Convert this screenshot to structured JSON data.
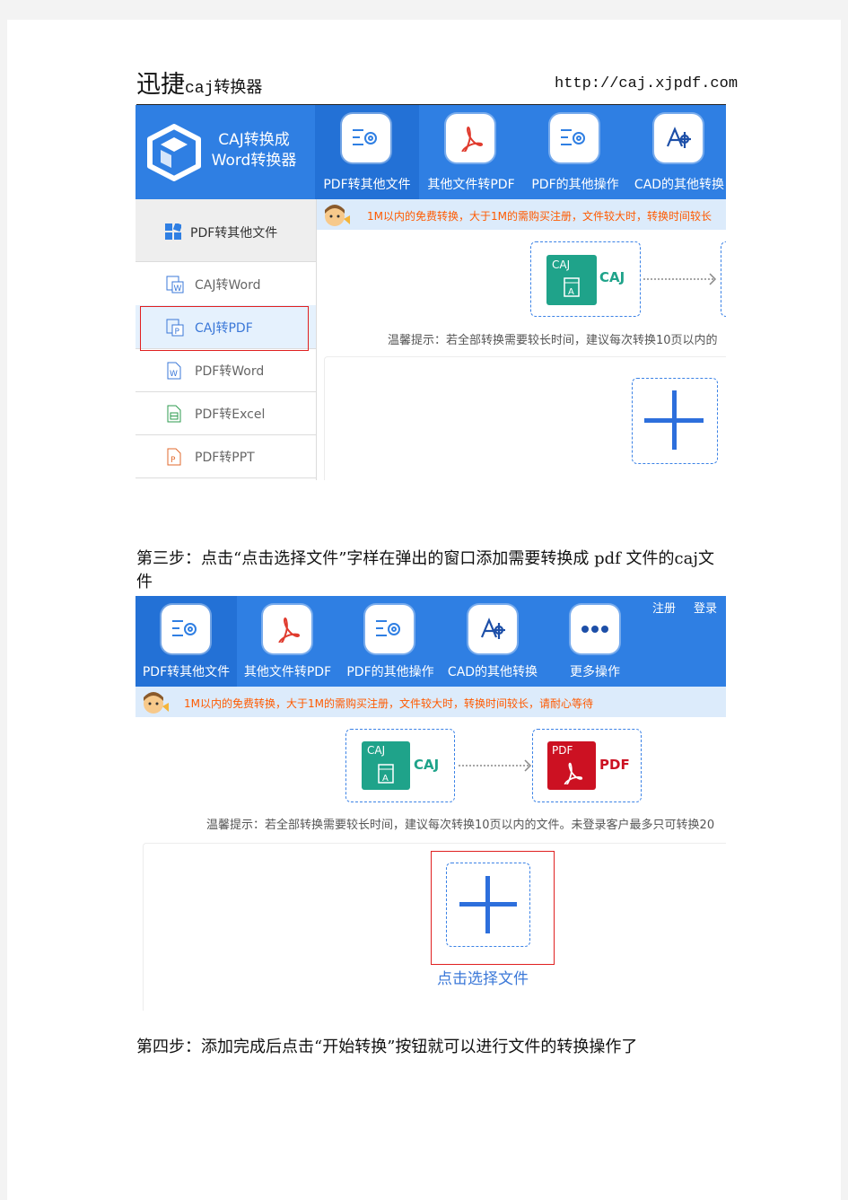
{
  "header": {
    "title_big": "迅捷",
    "title_small": "caj转换器",
    "url": "http://caj.xjpdf.com"
  },
  "shot1": {
    "brand": {
      "line1": "CAJ转换成",
      "line2": "Word转换器"
    },
    "tabs": [
      "PDF转其他文件",
      "其他文件转PDF",
      "PDF的其他操作",
      "CAD的其他转换"
    ],
    "notice": "1M以内的免费转换，大于1M的需购买注册，文件较大时，转换时间较长",
    "sidebar_header": "PDF转其他文件",
    "sidebar_items": [
      "CAJ转Word",
      "CAJ转PDF",
      "PDF转Word",
      "PDF转Excel",
      "PDF转PPT"
    ],
    "file_tag": "CAJ",
    "file_name": "CAJ",
    "hint": "温馨提示：若全部转换需要较长时间，建议每次转换10页以内的"
  },
  "step3": "第三步：点击“点击选择文件”字样在弹出的窗口添加需要转换成 pdf 文件的caj文件",
  "shot2": {
    "top_links": {
      "register": "注册",
      "login": "登录"
    },
    "tabs": [
      "PDF转其他文件",
      "其他文件转PDF",
      "PDF的其他操作",
      "CAD的其他转换",
      "更多操作"
    ],
    "notice": "1M以内的免费转换，大于1M的需购买注册，文件较大时，转换时间较长，请耐心等待",
    "from_tag": "CAJ",
    "from_name": "CAJ",
    "to_tag": "PDF",
    "to_name": "PDF",
    "hint": "温馨提示：若全部转换需要较长时间，建议每次转换10页以内的文件。未登录客户最多只可转换20",
    "choose_file": "点击选择文件"
  },
  "step4": "第四步：添加完成后点击“开始转换”按钮就可以进行文件的转换操作了",
  "colors": {
    "brand_blue": "#2f7fe3",
    "notice_orange": "#ff5a00",
    "highlight_red": "#e02020",
    "caj_teal": "#1fa38a",
    "pdf_red": "#cc1122"
  }
}
